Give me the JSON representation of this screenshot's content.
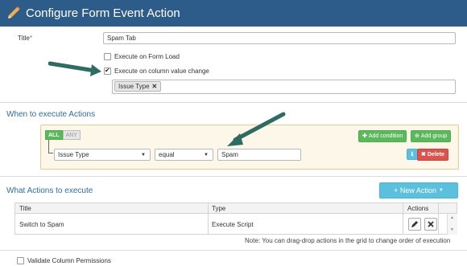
{
  "header": {
    "title": "Configure Form Event Action"
  },
  "form": {
    "title_label": "Title",
    "title_required_mark": "*",
    "title_value": "Spam Tab",
    "execute_on_load": {
      "label": "Execute on Form Load",
      "checked": false
    },
    "execute_on_change": {
      "label": "Execute on column value change",
      "checked": true
    },
    "columns": [
      {
        "label": "Issue Type",
        "remove": "✕"
      }
    ]
  },
  "when_section": {
    "title": "When to execute Actions",
    "match_all": "ALL",
    "match_any": "ANY",
    "add_condition": "Add condition",
    "add_group": "Add group",
    "condition": {
      "field": "Issue Type",
      "operator": "equal",
      "value": "Spam"
    },
    "delete_label": "Delete"
  },
  "actions_section": {
    "title": "What Actions to execute",
    "new_action": "+ New Action",
    "columns": {
      "title": "Title",
      "type": "Type",
      "actions": "Actions"
    },
    "rows": [
      {
        "title": "Switch to Spam",
        "type": "Execute Script"
      }
    ],
    "note": "Note: You can drag-drop actions in the grid to change order of execution"
  },
  "validate": {
    "label": "Validate Column Permissions",
    "checked": false
  },
  "colors": {
    "header": "#2e5c8a",
    "accent_green": "#5cb85c",
    "accent_red": "#d9534f",
    "accent_info": "#5bc0de",
    "arrow": "#2e6b63"
  }
}
